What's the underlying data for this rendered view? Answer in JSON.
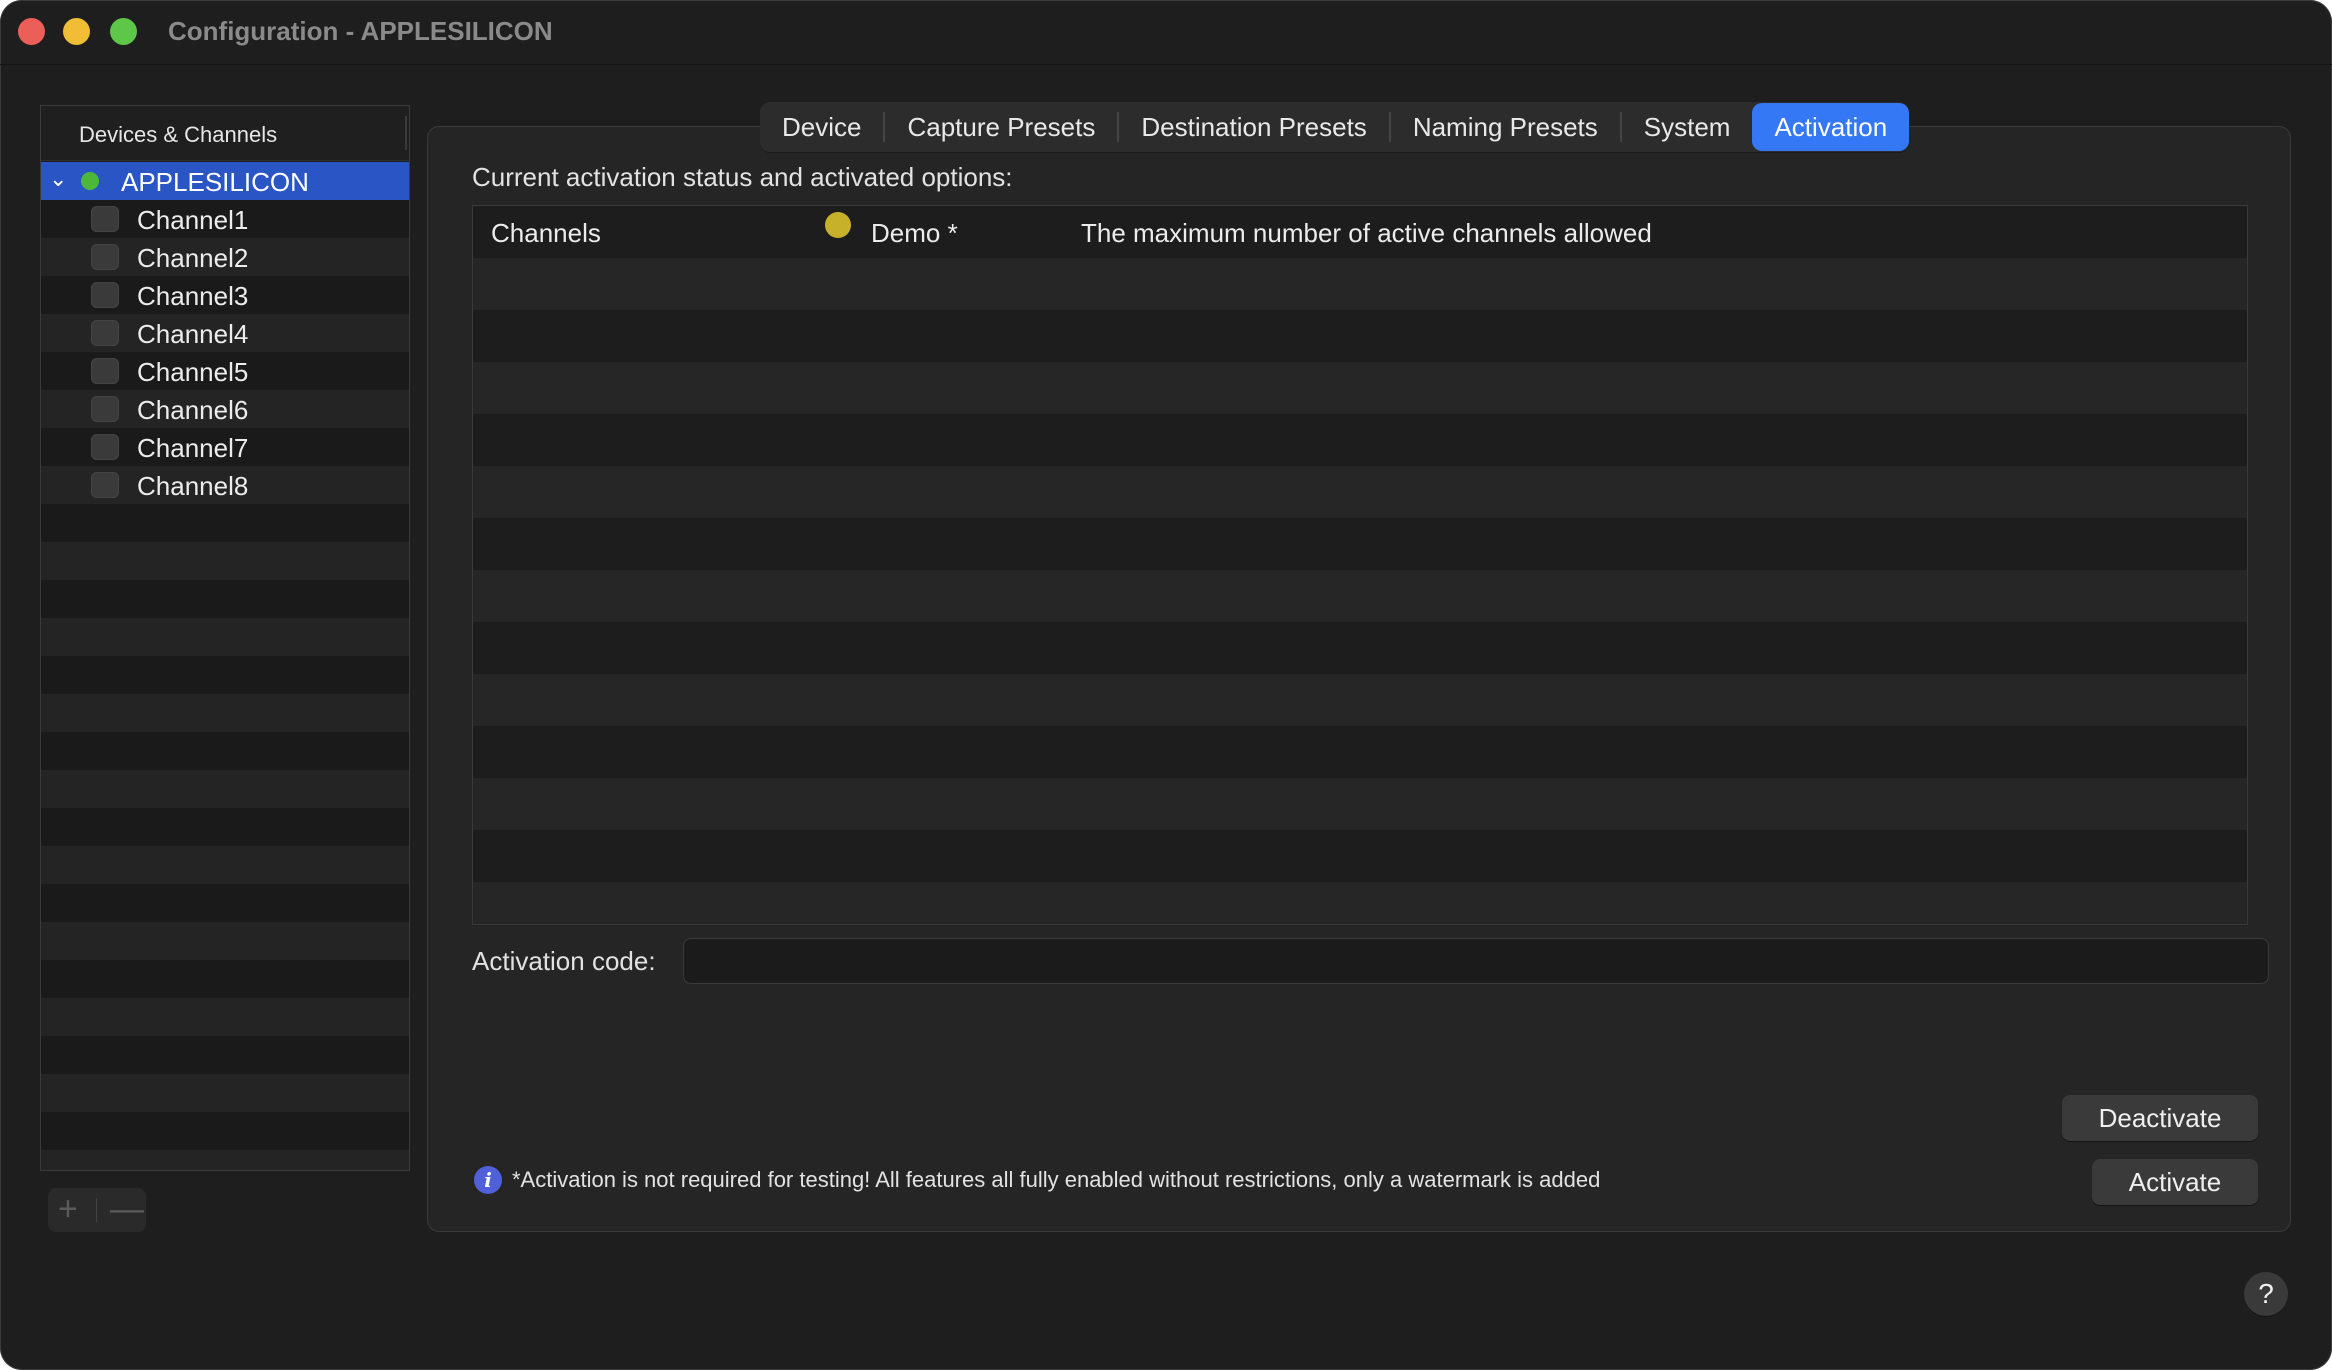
{
  "window": {
    "title": "Configuration - APPLESILICON"
  },
  "sidebar": {
    "header": "Devices & Channels",
    "device": {
      "label": "APPLESILICON",
      "status_color": "#4cb83a"
    },
    "channels": [
      "Channel1",
      "Channel2",
      "Channel3",
      "Channel4",
      "Channel5",
      "Channel6",
      "Channel7",
      "Channel8"
    ],
    "add_icon": "+",
    "remove_icon": "—"
  },
  "tabs": [
    {
      "label": "Device"
    },
    {
      "label": "Capture Presets"
    },
    {
      "label": "Destination Presets"
    },
    {
      "label": "Naming Presets"
    },
    {
      "label": "System"
    },
    {
      "label": "Activation",
      "active": true
    }
  ],
  "activation": {
    "status_label": "Current activation status and activated options:",
    "rows": [
      {
        "name": "Channels",
        "status_color": "#c8b12a",
        "type": "Demo *",
        "description": "The maximum number of active channels allowed"
      }
    ],
    "code_label": "Activation code:",
    "code_value": "",
    "deactivate_label": "Deactivate",
    "activate_label": "Activate",
    "info_icon": "i",
    "info_text": "*Activation is not required for testing! All features all fully enabled without restrictions, only a watermark is added"
  },
  "help_label": "?",
  "colors": {
    "accent": "#3478f6",
    "selection": "#2a55c5",
    "background": "#1e1e1e"
  }
}
